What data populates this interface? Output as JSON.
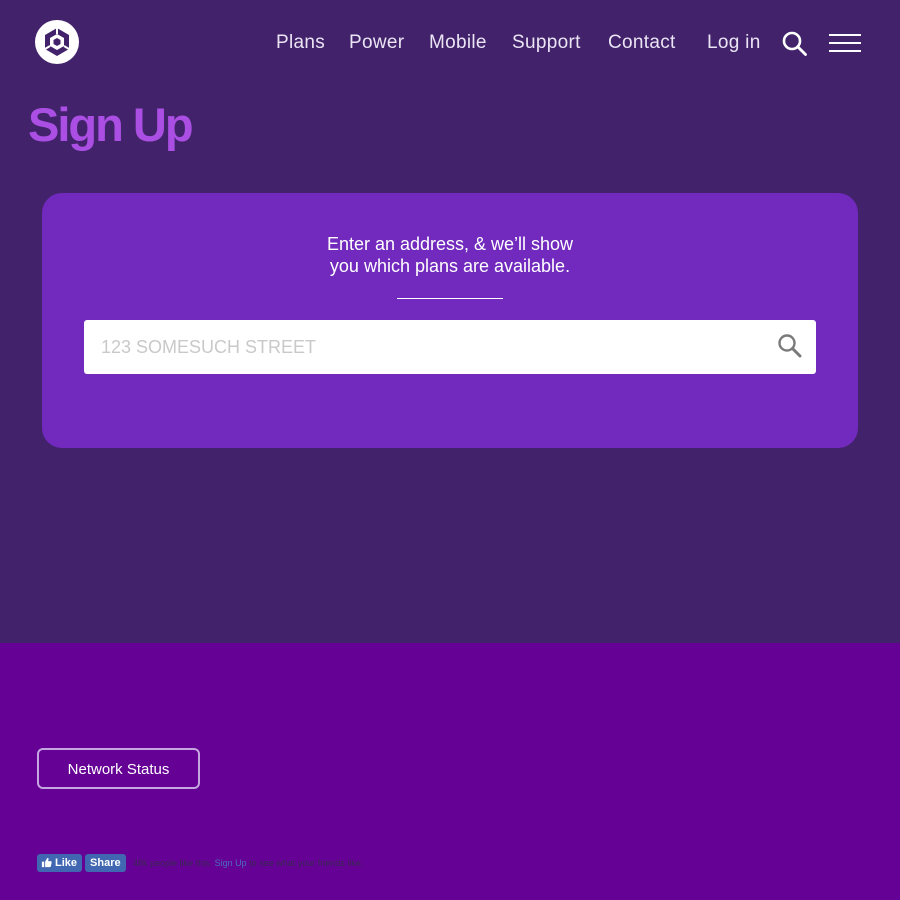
{
  "header": {
    "logo_icon": "hexagon-cube-logo",
    "nav": [
      {
        "label": "Plans"
      },
      {
        "label": "Power"
      },
      {
        "label": "Mobile"
      },
      {
        "label": "Support"
      },
      {
        "label": "Contact"
      },
      {
        "label": "Log in"
      }
    ],
    "search_icon": "search-icon",
    "menu_icon": "hamburger-menu-icon"
  },
  "page": {
    "title": "Sign Up"
  },
  "address_card": {
    "line1": "Enter an address, & we’ll show",
    "line2": "you which plans are available.",
    "input_value": "",
    "input_placeholder": "123 SOMESUCH STREET",
    "search_icon": "search-icon"
  },
  "footer": {
    "network_status_label": "Network Status",
    "facebook": {
      "like_label": "Like",
      "share_label": "Share",
      "count_text": "48k people like this.",
      "signup_link": "Sign Up",
      "suffix_text": "to see what your friends like."
    }
  },
  "colors": {
    "page_background": "#42236b",
    "card_background": "#7229bd",
    "title_color": "#ab4fe4",
    "footer_background": "#650194",
    "facebook_blue": "#4267b2"
  }
}
